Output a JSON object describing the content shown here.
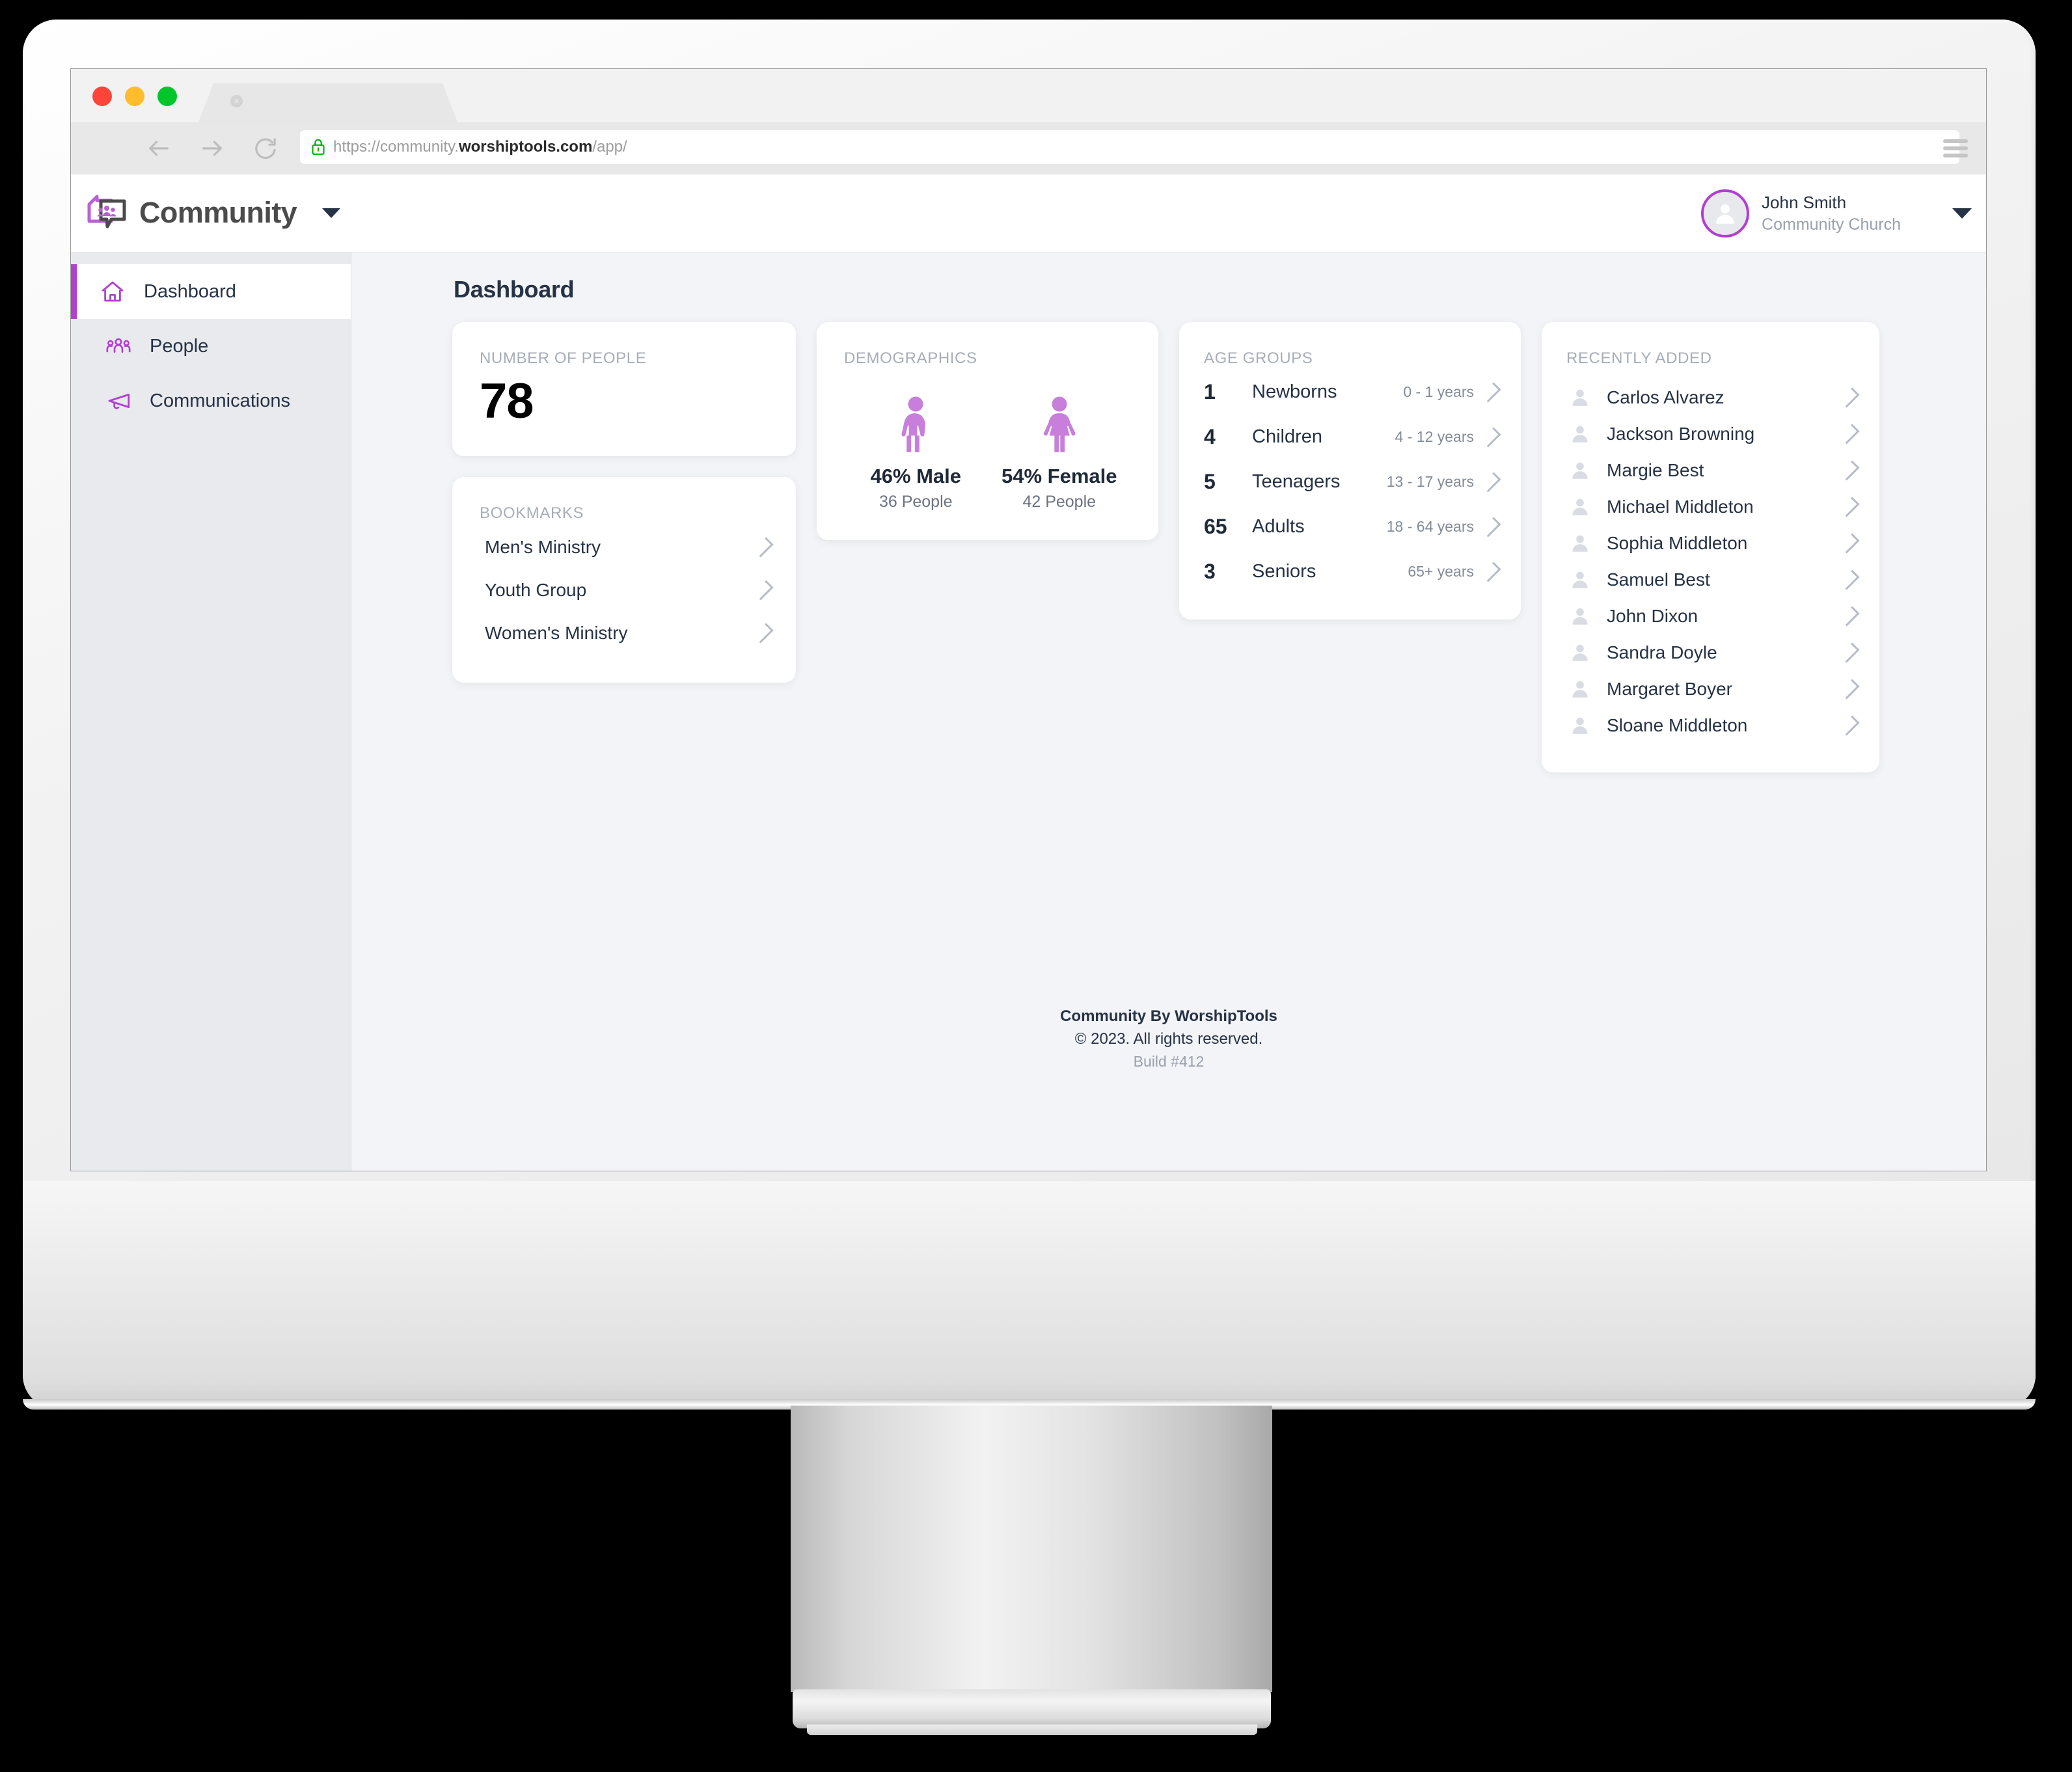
{
  "browser": {
    "url_prefix": "https://community.",
    "url_domain": "worshiptools.com",
    "url_suffix": "/app/",
    "tab_close_label": "×",
    "lock_icon": "lock-icon",
    "back_icon": "arrow-left-icon",
    "forward_icon": "arrow-right-icon",
    "reload_icon": "reload-icon",
    "menu_icon": "hamburger-menu-icon"
  },
  "header": {
    "app_title": "Community",
    "logo_icon": "community-speech-bubble-icon",
    "brand_caret_icon": "chevron-down-icon",
    "user": {
      "name": "John Smith",
      "organization": "Community Church",
      "avatar_icon": "person-avatar-icon",
      "caret_icon": "chevron-down-icon"
    }
  },
  "sidebar": {
    "items": [
      {
        "label": "Dashboard",
        "icon": "home-icon",
        "active": true
      },
      {
        "label": "People",
        "icon": "people-icon",
        "active": false
      },
      {
        "label": "Communications",
        "icon": "megaphone-icon",
        "active": false
      }
    ]
  },
  "main": {
    "page_title": "Dashboard",
    "number_of_people": {
      "label": "NUMBER OF PEOPLE",
      "value": "78"
    },
    "bookmarks": {
      "label": "BOOKMARKS",
      "items": [
        {
          "label": "Men's Ministry"
        },
        {
          "label": "Youth Group"
        },
        {
          "label": "Women's Ministry"
        }
      ]
    },
    "demographics": {
      "label": "DEMOGRAPHICS",
      "male": {
        "icon": "male-figure-icon",
        "percent": "46% Male",
        "count": "36 People"
      },
      "female": {
        "icon": "female-figure-icon",
        "percent": "54% Female",
        "count": "42 People"
      }
    },
    "age_groups": {
      "label": "AGE GROUPS",
      "rows": [
        {
          "count": "1",
          "name": "Newborns",
          "range": "0 - 1 years"
        },
        {
          "count": "4",
          "name": "Children",
          "range": "4 - 12 years"
        },
        {
          "count": "5",
          "name": "Teenagers",
          "range": "13 - 17 years"
        },
        {
          "count": "65",
          "name": "Adults",
          "range": "18 - 64 years"
        },
        {
          "count": "3",
          "name": "Seniors",
          "range": "65+ years"
        }
      ]
    },
    "recently_added": {
      "label": "RECENTLY ADDED",
      "people": [
        {
          "name": "Carlos Alvarez"
        },
        {
          "name": "Jackson Browning"
        },
        {
          "name": "Margie Best"
        },
        {
          "name": "Michael Middleton"
        },
        {
          "name": "Sophia Middleton"
        },
        {
          "name": "Samuel Best"
        },
        {
          "name": "John Dixon"
        },
        {
          "name": "Sandra Doyle"
        },
        {
          "name": "Margaret Boyer"
        },
        {
          "name": "Sloane Middleton"
        }
      ]
    },
    "footer": {
      "brand": "Community By WorshipTools",
      "copyright": "© 2023. All rights reserved.",
      "build": "Build #412"
    }
  },
  "colors": {
    "accent_purple": "#b13fd0",
    "figure_purple": "#c77fdb",
    "text_dark": "#263245",
    "text_muted": "#9aa1ae",
    "sidebar_bg": "#e9eaee",
    "main_bg": "#f3f4f7",
    "traffic_close": "#ff453a",
    "traffic_minimize": "#ffbd2e",
    "traffic_zoom": "#00c62c",
    "lock_green": "#00b412"
  }
}
